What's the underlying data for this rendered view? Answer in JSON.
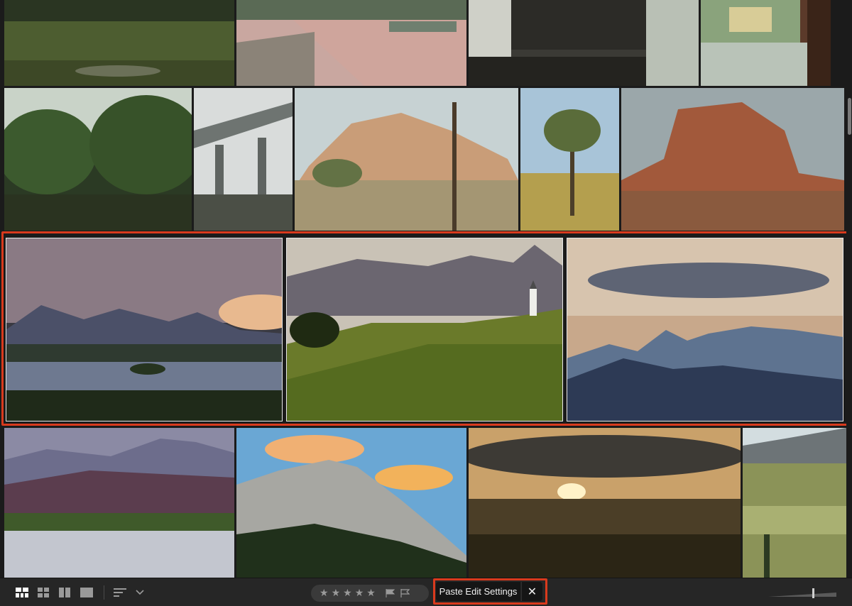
{
  "toolbar": {
    "paste_label": "Paste Edit Settings",
    "close_symbol": "✕",
    "stars": [
      "★",
      "★",
      "★",
      "★",
      "★"
    ],
    "view_icons": [
      "grid-large-icon",
      "grid-small-icon",
      "compare-icon",
      "single-view-icon"
    ],
    "sort_icon": "sort-icon",
    "flag_icons": [
      "pick-flag-icon",
      "reject-flag-icon"
    ],
    "zoom_level": 0.66
  },
  "colors": {
    "accent": "#d93a1d",
    "background": "#1b1b1b",
    "toolbar": "#262626"
  }
}
